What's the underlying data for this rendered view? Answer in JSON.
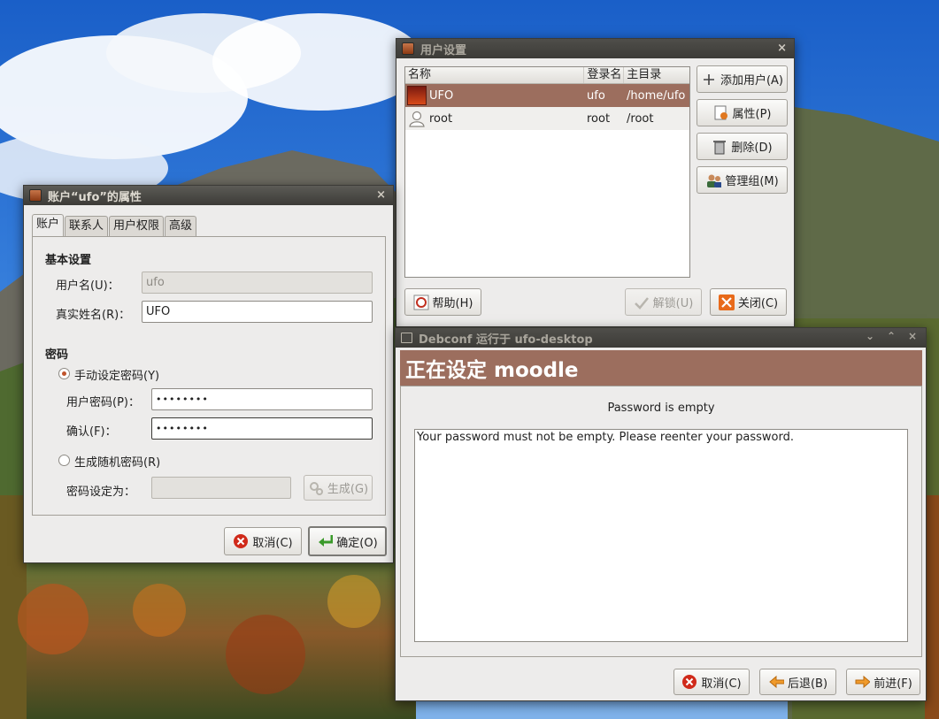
{
  "colors": {
    "accent": "#9c6e5e",
    "titlebar": "#3c3b37",
    "window_bg": "#edeceb"
  },
  "user_settings": {
    "title": "用户设置",
    "columns": [
      "名称",
      "登录名",
      "主目录"
    ],
    "users": [
      {
        "name": "UFO",
        "login": "ufo",
        "home": "/home/ufo",
        "selected": true
      },
      {
        "name": "root",
        "login": "root",
        "home": "/root",
        "selected": false
      }
    ],
    "buttons": {
      "add": "添加用户(A)",
      "properties": "属性(P)",
      "delete": "删除(D)",
      "manage_groups": "管理组(M)",
      "help": "帮助(H)",
      "unlock": "解锁(U)",
      "close": "关闭(C)"
    }
  },
  "properties_dialog": {
    "title": "账户“ufo”的属性",
    "tabs": [
      "账户",
      "联系人",
      "用户权限",
      "高级"
    ],
    "active_tab": "账户",
    "basic_settings": "基本设置",
    "username_label": "用户名(U)：",
    "username_value": "ufo",
    "realname_label": "真实姓名(R)：",
    "realname_value": "UFO",
    "password_section": "密码",
    "manual_password": "手动设定密码(Y)",
    "user_password_label": "用户密码(P)：",
    "user_password_value": "••••••••",
    "confirm_label": "确认(F)：",
    "confirm_value": "••••••••",
    "random_password": "生成随机密码(R)",
    "password_set_label": "密码设定为：",
    "generate_button": "生成(G)",
    "cancel_button": "取消(C)",
    "ok_button": "确定(O)"
  },
  "debconf": {
    "title": "Debconf 运行于 ufo-desktop",
    "banner": "正在设定 moodle",
    "message_title": "Password is empty",
    "message_body": "Your password must not be empty. Please reenter your password.",
    "buttons": {
      "cancel": "取消(C)",
      "back": "后退(B)",
      "forward": "前进(F)"
    }
  }
}
